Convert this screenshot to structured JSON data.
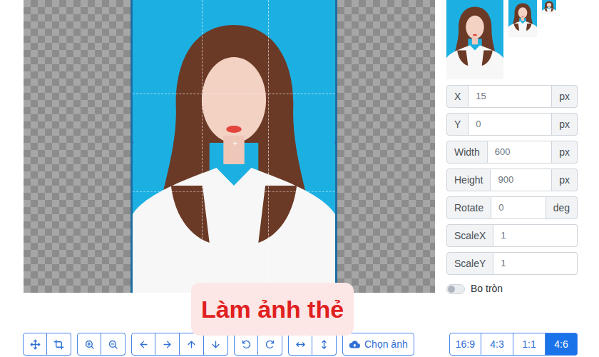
{
  "fields": [
    {
      "label": "X",
      "value": "15",
      "unit": "px"
    },
    {
      "label": "Y",
      "value": "0",
      "unit": "px"
    },
    {
      "label": "Width",
      "value": "600",
      "unit": "px"
    },
    {
      "label": "Height",
      "value": "900",
      "unit": "px"
    },
    {
      "label": "Rotate",
      "value": "0",
      "unit": "deg"
    },
    {
      "label": "ScaleX",
      "value": "1"
    },
    {
      "label": "ScaleY",
      "value": "1"
    }
  ],
  "toggle": {
    "label": "Bo tròn",
    "on": false
  },
  "choose_button": {
    "label": "Chọn ảnh"
  },
  "ratios": [
    {
      "label": "16:9",
      "selected": false
    },
    {
      "label": "4:3",
      "selected": false
    },
    {
      "label": "1:1",
      "selected": false
    },
    {
      "label": "4:6",
      "selected": true
    }
  ],
  "caption": "Làm ảnh thẻ"
}
